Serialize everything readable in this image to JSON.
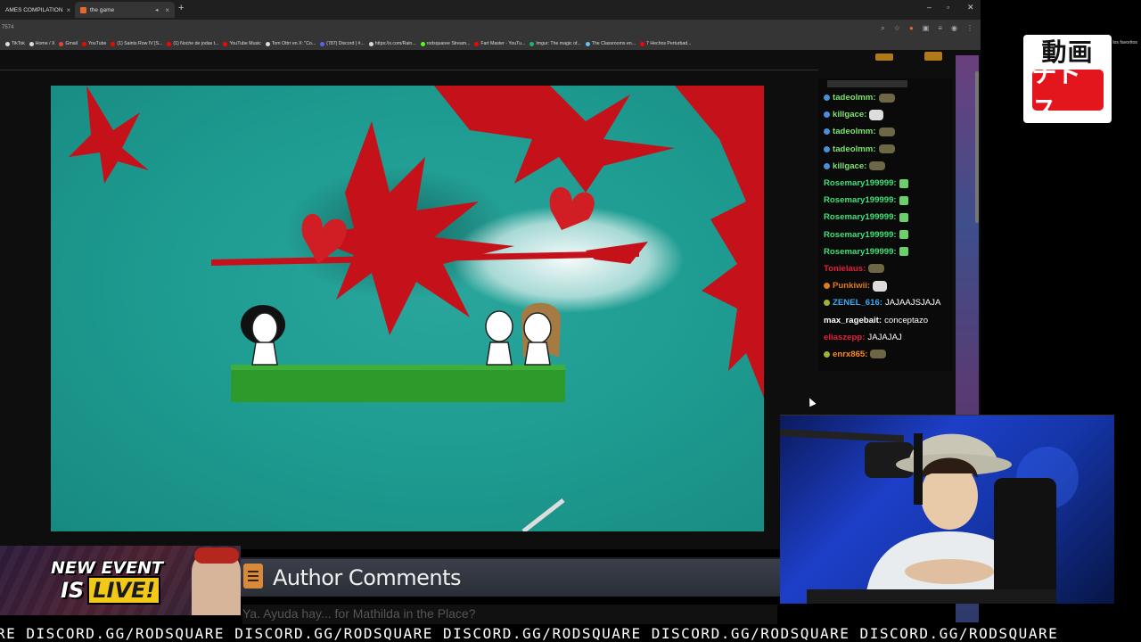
{
  "browser": {
    "tabs": [
      {
        "label": "AMES COMPILATION"
      },
      {
        "label": "the game"
      }
    ],
    "address": "7574",
    "bookmarks": [
      {
        "label": "TikTok",
        "color": "#ddd"
      },
      {
        "label": "Home / X",
        "color": "#ddd"
      },
      {
        "label": "Gmail",
        "color": "#ea4335"
      },
      {
        "label": "YouTube",
        "color": "#ff0000"
      },
      {
        "label": "(1) Saints Row IV [S...",
        "color": "#ff0000"
      },
      {
        "label": "(1) Noche de jodas t...",
        "color": "#ff0000"
      },
      {
        "label": "YouTube Music",
        "color": "#ff0000"
      },
      {
        "label": "Tom Ottrr en X: \"Co...",
        "color": "#ddd"
      },
      {
        "label": "(787) Discord | #...",
        "color": "#5865f2"
      },
      {
        "label": "https://x.com/Rain...",
        "color": "#ddd"
      },
      {
        "label": "rodsquaree Stream...",
        "color": "#53fc18"
      },
      {
        "label": "Fart Master - YouTu...",
        "color": "#ff0000"
      },
      {
        "label": "Imgur: The magic of...",
        "color": "#1bb76e"
      },
      {
        "label": "The Classrooms en...",
        "color": "#66c0f4"
      },
      {
        "label": "7 Hechos Perturbad...",
        "color": "#ff0000"
      }
    ],
    "all_favorites": "Todos los favoritos"
  },
  "chat": {
    "messages": [
      {
        "user": "tadeolmm:",
        "color": "#7ee36d",
        "icon": "blue",
        "emote": "gold",
        "text": ""
      },
      {
        "user": "killgace:",
        "color": "#7ee36d",
        "icon": "blue",
        "emote": "white",
        "text": ""
      },
      {
        "user": "tadeolmm:",
        "color": "#7ee36d",
        "icon": "blue",
        "emote": "gold",
        "text": ""
      },
      {
        "user": "tadeolmm:",
        "color": "#7ee36d",
        "icon": "blue",
        "emote": "gold",
        "text": ""
      },
      {
        "user": "killgace:",
        "color": "#7ee36d",
        "icon": "blue",
        "emote": "gold",
        "text": ""
      },
      {
        "user": "Rosemary199999:",
        "color": "#3fe07a",
        "icon": "",
        "emote": "green",
        "text": ""
      },
      {
        "user": "Rosemary199999:",
        "color": "#3fe07a",
        "icon": "",
        "emote": "green",
        "text": ""
      },
      {
        "user": "Rosemary199999:",
        "color": "#3fe07a",
        "icon": "",
        "emote": "green",
        "text": ""
      },
      {
        "user": "Rosemary199999:",
        "color": "#3fe07a",
        "icon": "",
        "emote": "green",
        "text": ""
      },
      {
        "user": "Rosemary199999:",
        "color": "#3fe07a",
        "icon": "",
        "emote": "green",
        "text": ""
      },
      {
        "user": "Tonielaus:",
        "color": "#e0213c",
        "icon": "",
        "emote": "gold",
        "text": ""
      },
      {
        "user": "Punkiwii:",
        "color": "#e0791c",
        "icon": "orange",
        "emote": "white",
        "text": ""
      },
      {
        "user": "ZENEL_616:",
        "color": "#3ba8f0",
        "icon": "green",
        "emote": "",
        "text": "JAJAAJSJAJA"
      },
      {
        "user": "max_ragebait:",
        "color": "#ffffff",
        "icon": "",
        "emote": "",
        "text": "conceptazo"
      },
      {
        "user": "eliaszepp:",
        "color": "#e0213c",
        "icon": "",
        "emote": "",
        "text": "JAJAJAJ"
      },
      {
        "user": "enrx865:",
        "color": "#ff8a1c",
        "icon": "green",
        "emote": "gold",
        "text": ""
      }
    ]
  },
  "logo": {
    "top": "動画",
    "bottom": "チドス"
  },
  "event": {
    "line1": "NEW EVENT",
    "line2a": "IS",
    "line2b": "LIVE!"
  },
  "author": {
    "title": "Author Comments",
    "subtitle": "Ya. Ayuda hay... for Mathilda in the Place?"
  },
  "ticker": "RE DISCORD.GG/RODSQUARE DISCORD.GG/RODSQUARE DISCORD.GG/RODSQUARE DISCORD.GG/RODSQUARE DISCORD.GG/RODSQUARE",
  "colors": {
    "game_bg": "#1f9d92",
    "blood": "#c4111a",
    "grass": "#2e9a2b"
  }
}
